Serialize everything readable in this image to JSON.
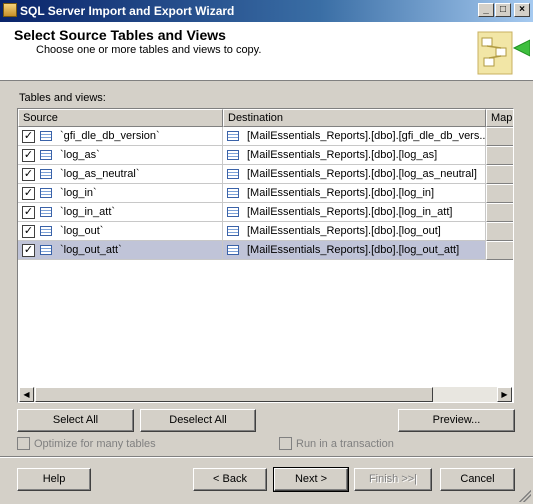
{
  "window": {
    "title": "SQL Server Import and Export Wizard"
  },
  "header": {
    "title": "Select Source Tables and Views",
    "subtitle": "Choose one or more tables and views to copy."
  },
  "grid": {
    "label": "Tables and views:",
    "columns": {
      "source": "Source",
      "destination": "Destination",
      "mapping": "Map"
    },
    "rows": [
      {
        "checked": true,
        "source": "`gfi_dle_db_version`",
        "destination": "[MailEssentials_Reports].[dbo].[gfi_dle_db_vers..."
      },
      {
        "checked": true,
        "source": "`log_as`",
        "destination": "[MailEssentials_Reports].[dbo].[log_as]"
      },
      {
        "checked": true,
        "source": "`log_as_neutral`",
        "destination": "[MailEssentials_Reports].[dbo].[log_as_neutral]"
      },
      {
        "checked": true,
        "source": "`log_in`",
        "destination": "[MailEssentials_Reports].[dbo].[log_in]"
      },
      {
        "checked": true,
        "source": "`log_in_att`",
        "destination": "[MailEssentials_Reports].[dbo].[log_in_att]"
      },
      {
        "checked": true,
        "source": "`log_out`",
        "destination": "[MailEssentials_Reports].[dbo].[log_out]"
      },
      {
        "checked": true,
        "source": "`log_out_att`",
        "destination": "[MailEssentials_Reports].[dbo].[log_out_att]",
        "selected": true
      }
    ]
  },
  "buttons": {
    "select_all": "Select All",
    "deselect_all": "Deselect All",
    "preview": "Preview...",
    "help": "Help",
    "back": "< Back",
    "next": "Next >",
    "finish": "Finish >>|",
    "cancel": "Cancel"
  },
  "options": {
    "optimize": "Optimize for many tables",
    "transaction": "Run in a transaction"
  },
  "colors": {
    "titlebar": "#0a246a",
    "selection": "#c0c4d8",
    "face": "#d4d0c8"
  }
}
